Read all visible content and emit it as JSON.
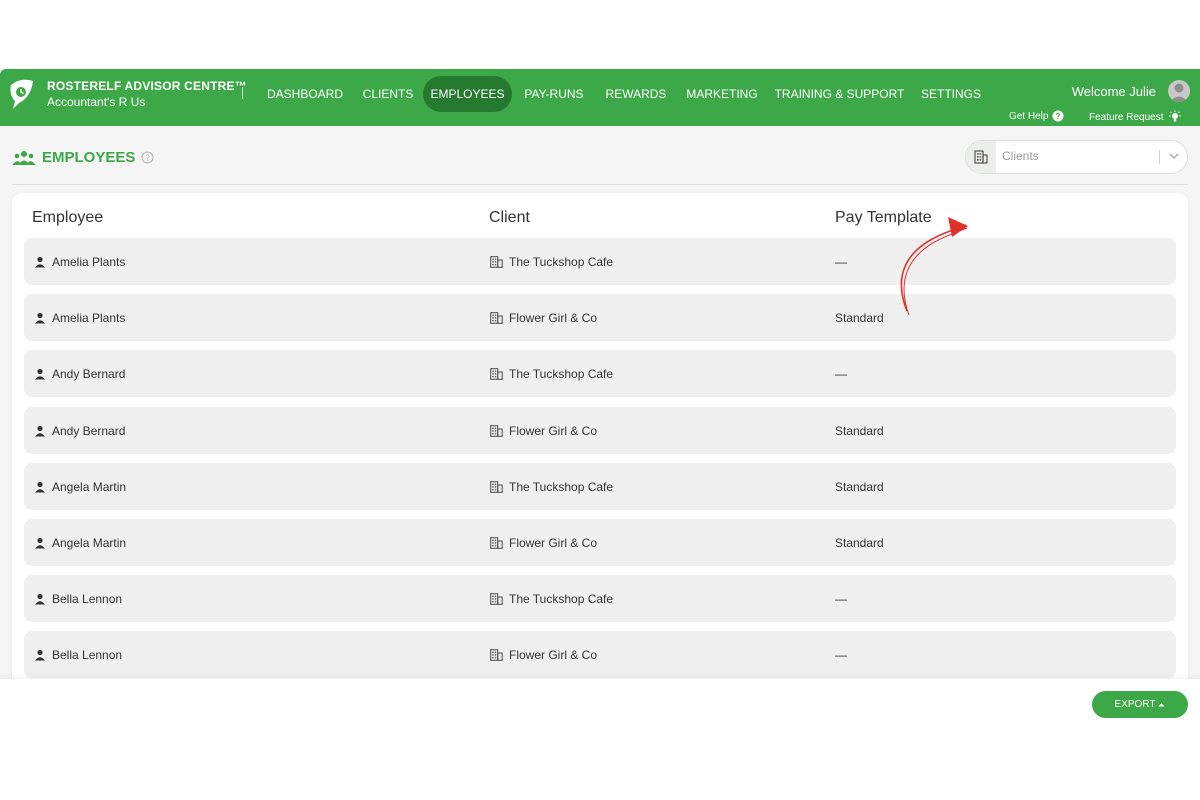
{
  "brand": {
    "title": "ROSTERELF ADVISOR CENTRE™",
    "subtitle": "Accountant's R Us"
  },
  "nav": [
    {
      "label": "DASHBOARD",
      "active": false
    },
    {
      "label": "CLIENTS",
      "active": false
    },
    {
      "label": "EMPLOYEES",
      "active": true
    },
    {
      "label": "PAY-RUNS",
      "active": false
    },
    {
      "label": "REWARDS",
      "active": false
    },
    {
      "label": "MARKETING",
      "active": false
    },
    {
      "label": "TRAINING & SUPPORT",
      "active": false
    },
    {
      "label": "SETTINGS",
      "active": false
    }
  ],
  "user": {
    "welcome": "Welcome Julie"
  },
  "help": {
    "get_help": "Get Help",
    "feature_request": "Feature Request"
  },
  "page": {
    "title": "EMPLOYEES"
  },
  "filter": {
    "placeholder": "Clients"
  },
  "table": {
    "headers": {
      "employee": "Employee",
      "client": "Client",
      "pay_template": "Pay Template"
    },
    "rows": [
      {
        "employee": "Amelia Plants",
        "client": "The Tuckshop Cafe",
        "pay_template": "—"
      },
      {
        "employee": "Amelia Plants",
        "client": "Flower Girl & Co",
        "pay_template": "Standard"
      },
      {
        "employee": "Andy Bernard",
        "client": "The Tuckshop Cafe",
        "pay_template": "—"
      },
      {
        "employee": "Andy Bernard",
        "client": "Flower Girl & Co",
        "pay_template": "Standard"
      },
      {
        "employee": "Angela Martin",
        "client": "The Tuckshop Cafe",
        "pay_template": "Standard"
      },
      {
        "employee": "Angela Martin",
        "client": "Flower Girl & Co",
        "pay_template": "Standard"
      },
      {
        "employee": "Bella Lennon",
        "client": "The Tuckshop Cafe",
        "pay_template": "—"
      },
      {
        "employee": "Bella Lennon",
        "client": "Flower Girl & Co",
        "pay_template": "—"
      }
    ]
  },
  "footer": {
    "export_label": "EXPORT"
  },
  "colors": {
    "brand_green": "#3da847",
    "active_nav": "#267a2f",
    "row_bg": "#eeefee",
    "annotation_red": "#e0312b"
  }
}
